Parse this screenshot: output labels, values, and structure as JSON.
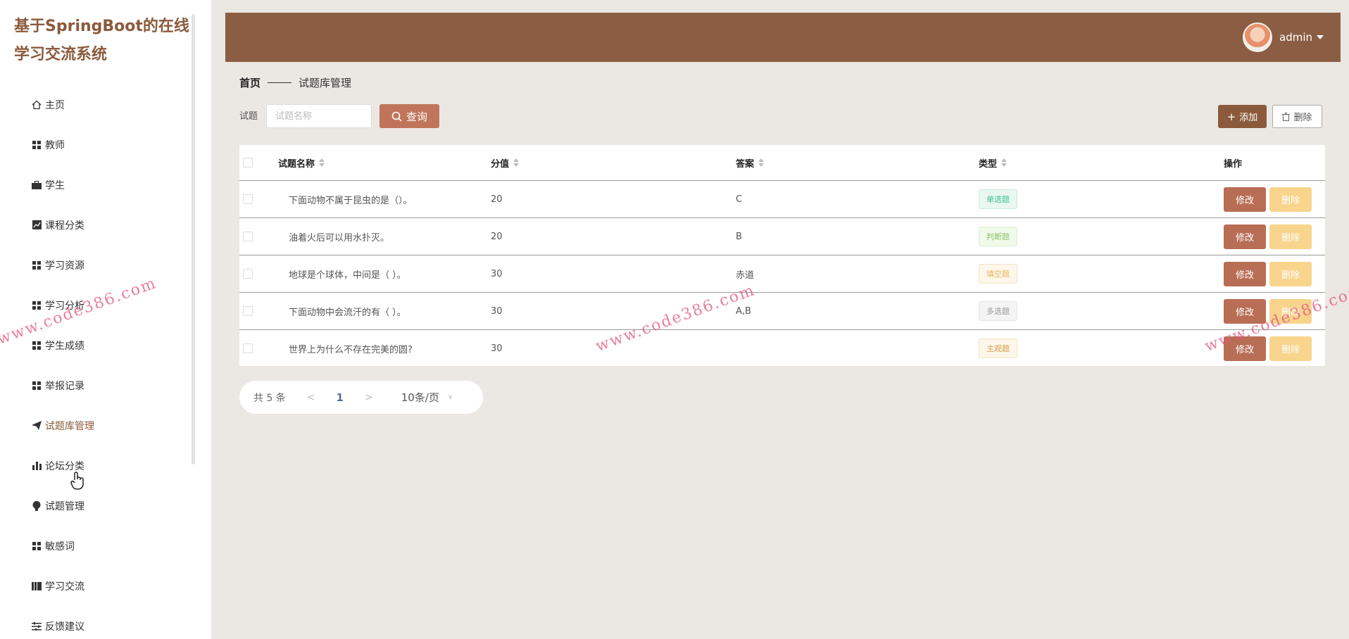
{
  "app": {
    "title": "基于SpringBoot的在线学习交流系统"
  },
  "sidebar": {
    "items": [
      {
        "label": "主页",
        "icon": "home-icon"
      },
      {
        "label": "教师",
        "icon": "grid-icon"
      },
      {
        "label": "学生",
        "icon": "briefcase-icon"
      },
      {
        "label": "课程分类",
        "icon": "chart-icon"
      },
      {
        "label": "学习资源",
        "icon": "grid-icon"
      },
      {
        "label": "学习分析",
        "icon": "grid-icon"
      },
      {
        "label": "学生成绩",
        "icon": "grid-icon"
      },
      {
        "label": "举报记录",
        "icon": "grid-icon"
      },
      {
        "label": "试题库管理",
        "icon": "paper-plane-icon"
      },
      {
        "label": "论坛分类",
        "icon": "bar-chart-icon"
      },
      {
        "label": "试题管理",
        "icon": "bulb-icon"
      },
      {
        "label": "敏感词",
        "icon": "grid-icon"
      },
      {
        "label": "学习交流",
        "icon": "book-icon"
      },
      {
        "label": "反馈建议",
        "icon": "sliders-icon"
      }
    ]
  },
  "header": {
    "username": "admin"
  },
  "breadcrumb": {
    "home": "首页",
    "current": "试题库管理"
  },
  "search": {
    "label": "试题",
    "placeholder": "试题名称",
    "query_label": "查询"
  },
  "toolbar": {
    "add_label": "添加",
    "delete_label": "删除"
  },
  "table": {
    "columns": [
      "试题名称",
      "分值",
      "答案",
      "类型",
      "操作"
    ],
    "edit_label": "修改",
    "delete_label": "删除",
    "rows": [
      {
        "name": "下面动物不属于昆虫的是（）。",
        "score": "20",
        "answer": "C",
        "type": "单选题",
        "type_color": "#3fbf8f"
      },
      {
        "name": "油着火后可以用水扑灭。",
        "score": "20",
        "answer": "B",
        "type": "判断题",
        "type_color": "#8cc56a"
      },
      {
        "name": "地球是个球体，中间是（ ）。",
        "score": "30",
        "answer": "赤道",
        "type": "填空题",
        "type_color": "#e8b45e"
      },
      {
        "name": "下面动物中会流汗的有（ ）。",
        "score": "30",
        "answer": "A,B",
        "type": "多选题",
        "type_color": "#999999"
      },
      {
        "name": "世界上为什么不存在完美的圆?",
        "score": "30",
        "answer": "",
        "type": "主观题",
        "type_color": "#d4a04a"
      }
    ]
  },
  "pagination": {
    "total": "共 5 条",
    "prev": "<",
    "page": "1",
    "next": ">",
    "page_size": "10条/页"
  },
  "watermark": {
    "text": "www.code386.com"
  },
  "colors": {
    "accent": "#8b5a3c",
    "header": "#8b5e43",
    "query_button": "#c0755a",
    "edit_button": "#b86e55",
    "delete_button": "#f8d48c"
  }
}
